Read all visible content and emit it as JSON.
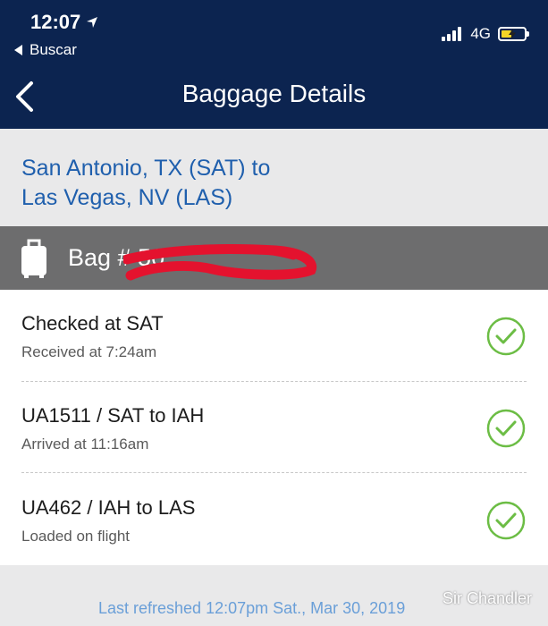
{
  "status_bar": {
    "time": "12:07",
    "back_app_label": "Buscar",
    "network": "4G"
  },
  "nav": {
    "title": "Baggage Details"
  },
  "route": {
    "line1": "San Antonio, TX (SAT) to",
    "line2": "Las Vegas, NV (LAS)"
  },
  "bag": {
    "label": "Bag # 50"
  },
  "events": [
    {
      "title": "Checked at SAT",
      "subtitle": "Received at 7:24am"
    },
    {
      "title": "UA1511 / SAT to IAH",
      "subtitle": "Arrived at 11:16am"
    },
    {
      "title": "UA462 / IAH to LAS",
      "subtitle": "Loaded on flight"
    }
  ],
  "footer": {
    "refreshed": "Last refreshed 12:07pm Sat., Mar 30, 2019",
    "watermark": "Sir Chandler"
  },
  "colors": {
    "header": "#0c2450",
    "route_text": "#1f5fad",
    "bag_bar": "#6d6d6e",
    "check": "#6cbd45",
    "refreshed_text": "#6a9fd8"
  }
}
